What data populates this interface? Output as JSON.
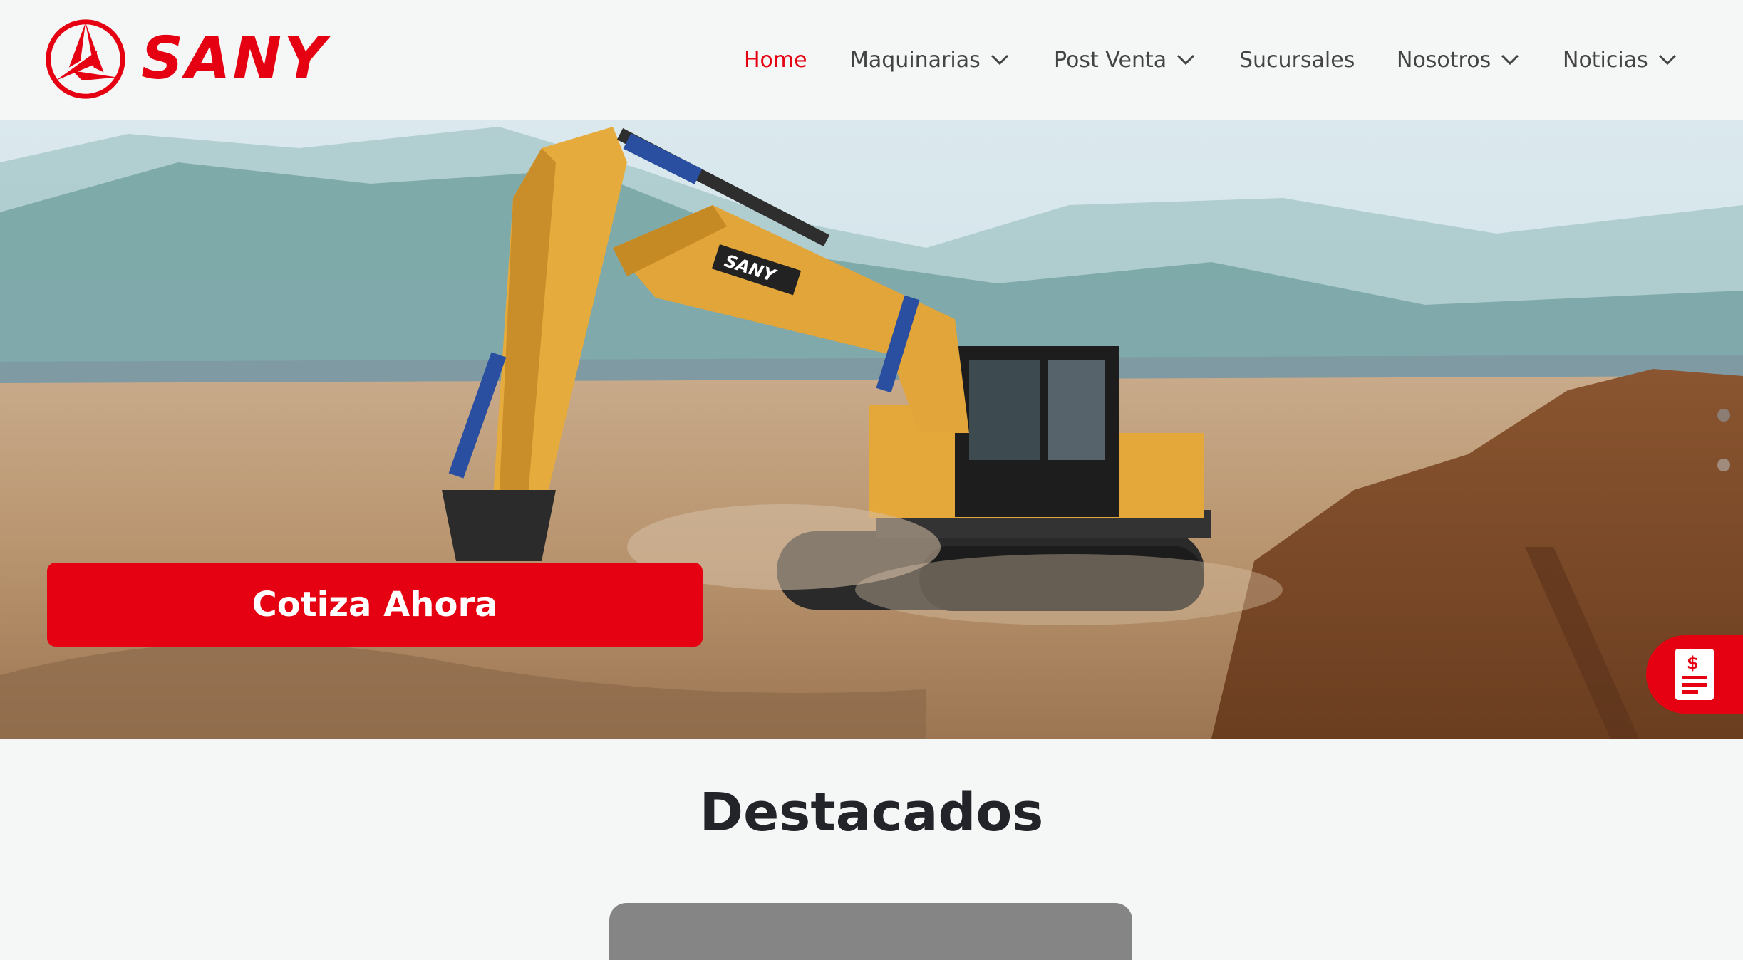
{
  "brand": {
    "name": "SANY",
    "color": "#e50012"
  },
  "nav": {
    "items": [
      {
        "label": "Home",
        "active": true,
        "has_dropdown": false
      },
      {
        "label": "Maquinarias",
        "active": false,
        "has_dropdown": true
      },
      {
        "label": "Post Venta",
        "active": false,
        "has_dropdown": true
      },
      {
        "label": "Sucursales",
        "active": false,
        "has_dropdown": false
      },
      {
        "label": "Nosotros",
        "active": false,
        "has_dropdown": true
      },
      {
        "label": "Noticias",
        "active": false,
        "has_dropdown": true
      }
    ]
  },
  "hero": {
    "cta_label": "Cotiza Ahora",
    "machine_brand": "SANY",
    "slider_dots": 2,
    "floating_button_icon": "quote-invoice-icon"
  },
  "featured": {
    "title": "Destacados"
  }
}
